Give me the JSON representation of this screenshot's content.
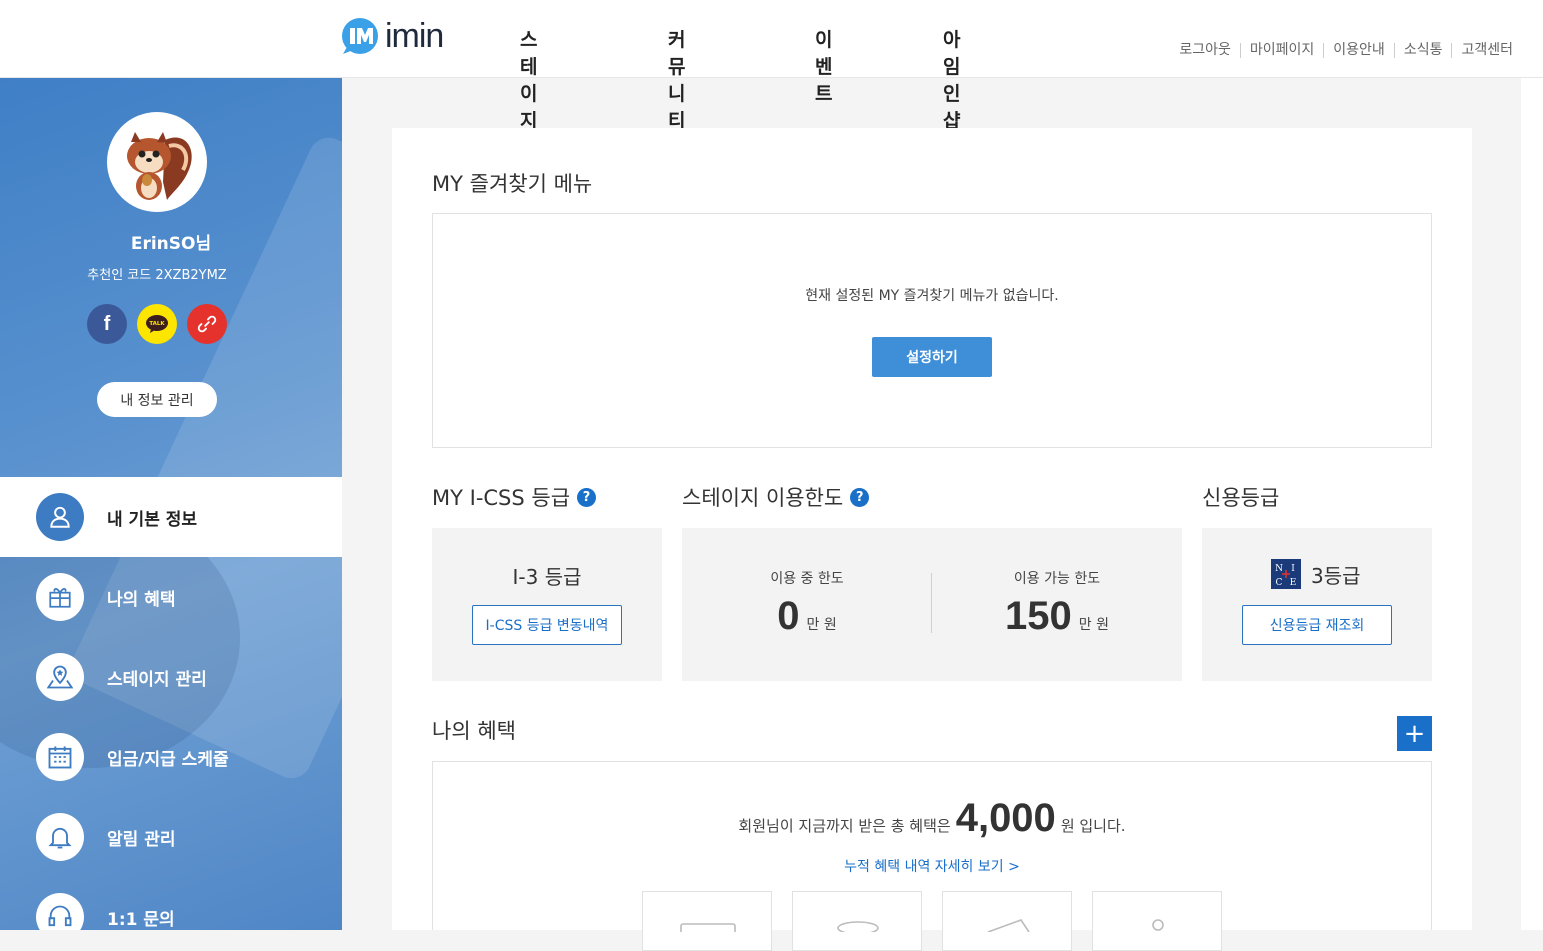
{
  "header": {
    "logo_text": "imin",
    "nav": [
      "스테이지",
      "커뮤니티",
      "이벤트",
      "아임인샵"
    ],
    "util": [
      "로그아웃",
      "마이페이지",
      "이용안내",
      "소식통",
      "고객센터"
    ]
  },
  "sidebar": {
    "nickname": "ErinSO님",
    "refcode_label": "추천인 코드",
    "refcode": "2XZB2YMZ",
    "sns": {
      "facebook": "f",
      "kakao": "TALK"
    },
    "my_info_button": "내 정보 관리",
    "menu": [
      {
        "label": "내 기본 정보",
        "icon": "person-icon",
        "active": true
      },
      {
        "label": "나의 혜택",
        "icon": "gift-icon",
        "active": false
      },
      {
        "label": "스테이지 관리",
        "icon": "map-pin-icon",
        "active": false
      },
      {
        "label": "입금/지급 스케줄",
        "icon": "calendar-icon",
        "active": false
      },
      {
        "label": "알림 관리",
        "icon": "bell-icon",
        "active": false
      },
      {
        "label": "1:1 문의",
        "icon": "headset-icon",
        "active": false
      }
    ]
  },
  "favorites": {
    "title": "MY 즐겨찾기 메뉴",
    "empty_message": "현재 설정된 MY 즐겨찾기 메뉴가 없습니다.",
    "setup_button": "설정하기"
  },
  "icss": {
    "title": "MY I-CSS 등급",
    "help": "?",
    "grade": "I-3 등급",
    "history_button": "I-CSS 등급 변동내역"
  },
  "stage_limit": {
    "title": "스테이지 이용한도",
    "help": "?",
    "in_use_label": "이용 중 한도",
    "in_use_value": "0",
    "available_label": "이용 가능 한도",
    "available_value": "150",
    "unit": "만 원"
  },
  "credit": {
    "title": "신용등급",
    "nice_logo": "NICE",
    "grade": "3등급",
    "recheck_button": "신용등급 재조회"
  },
  "benefits": {
    "title": "나의 혜택",
    "plus": "+",
    "prefix": "회원님이 지금까지 받은 총 혜택은",
    "amount": "4,000",
    "suffix": "원 입니다.",
    "detail_link": "누적 혜택 내역 자세히 보기 >"
  },
  "colors": {
    "primary": "#1a6fc9",
    "button_blue": "#3e8fd8",
    "sidebar_blue": "#4f86c6",
    "kakao": "#fde500",
    "facebook": "#3b5998",
    "link_red": "#e5322d"
  }
}
